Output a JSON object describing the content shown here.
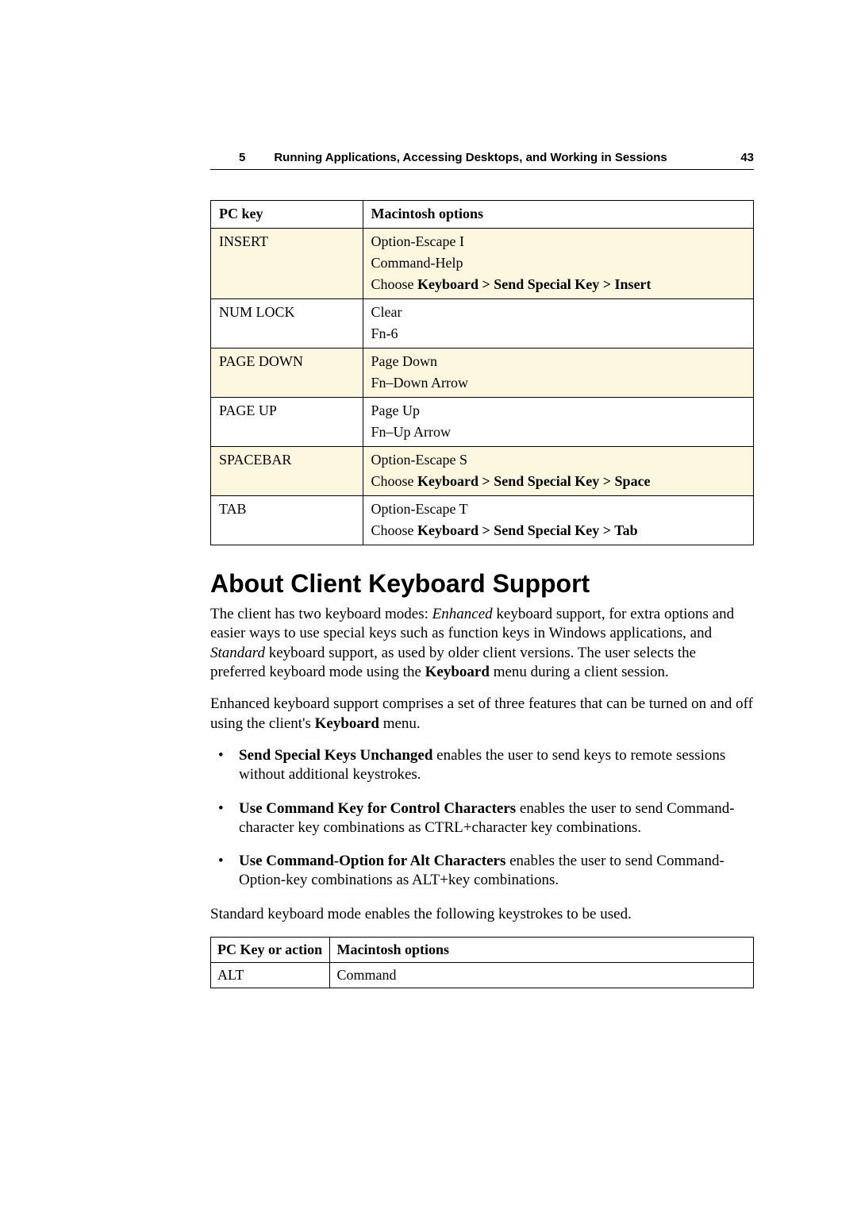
{
  "header": {
    "chapter_number": "5",
    "chapter_title": "Running Applications, Accessing Desktops, and Working in Sessions",
    "page_number": "43"
  },
  "table1": {
    "headers": {
      "col1": "PC key",
      "col2": "Macintosh options"
    },
    "rows": [
      {
        "key": "INSERT",
        "opts": [
          {
            "prefix": "",
            "bold": "",
            "text": "Option-Escape I"
          },
          {
            "prefix": "",
            "bold": "",
            "text": "Command-Help"
          },
          {
            "prefix": "Choose ",
            "bold": "Keyboard > Send Special Key > Insert",
            "text": ""
          }
        ],
        "alt": true
      },
      {
        "key": "NUM LOCK",
        "opts": [
          {
            "prefix": "",
            "bold": "",
            "text": "Clear"
          },
          {
            "prefix": "",
            "bold": "",
            "text": "Fn-6"
          }
        ],
        "alt": false
      },
      {
        "key": "PAGE DOWN",
        "opts": [
          {
            "prefix": "",
            "bold": "",
            "text": "Page Down"
          },
          {
            "prefix": "",
            "bold": "",
            "text": "Fn–Down Arrow"
          }
        ],
        "alt": true
      },
      {
        "key": "PAGE UP",
        "opts": [
          {
            "prefix": "",
            "bold": "",
            "text": "Page Up"
          },
          {
            "prefix": "",
            "bold": "",
            "text": "Fn–Up Arrow"
          }
        ],
        "alt": false
      },
      {
        "key": "SPACEBAR",
        "opts": [
          {
            "prefix": "",
            "bold": "",
            "text": "Option-Escape S"
          },
          {
            "prefix": "Choose ",
            "bold": "Keyboard > Send Special Key > Space",
            "text": ""
          }
        ],
        "alt": true
      },
      {
        "key": "TAB",
        "opts": [
          {
            "prefix": "",
            "bold": "",
            "text": "Option-Escape T"
          },
          {
            "prefix": "Choose ",
            "bold": "Keyboard > Send Special Key > Tab",
            "text": ""
          }
        ],
        "alt": false
      }
    ]
  },
  "section": {
    "title": "About Client Keyboard Support",
    "para1": {
      "pre": "The client has two keyboard modes: ",
      "em1": "Enhanced",
      "mid1": " keyboard support, for extra options and easier ways to use special keys such as function keys in Windows applications, and ",
      "em2": "Standard",
      "mid2": " keyboard support, as used by older client versions. The user selects the preferred keyboard mode using the ",
      "bold": "Keyboard",
      "post": " menu during a client session."
    },
    "para2": {
      "pre": "Enhanced keyboard support comprises a set of three features that can be turned on and off using the client's ",
      "bold": "Keyboard",
      "post": " menu."
    },
    "bullets": [
      {
        "bold": "Send Special Keys Unchanged",
        "text": " enables the user to send keys to remote sessions without additional keystrokes."
      },
      {
        "bold": "Use Command Key for Control Characters",
        "text": " enables the user to send Command-character key combinations as CTRL+character key combinations."
      },
      {
        "bold": "Use Command-Option for Alt Characters",
        "text": " enables the user to send Command-Option-key combinations as ALT+key combinations."
      }
    ],
    "para3": "Standard keyboard mode enables the following keystrokes to be used."
  },
  "table2": {
    "headers": {
      "col1": "PC Key or action",
      "col2": "Macintosh options"
    },
    "rows": [
      {
        "key": "ALT",
        "opt": "Command"
      }
    ]
  }
}
